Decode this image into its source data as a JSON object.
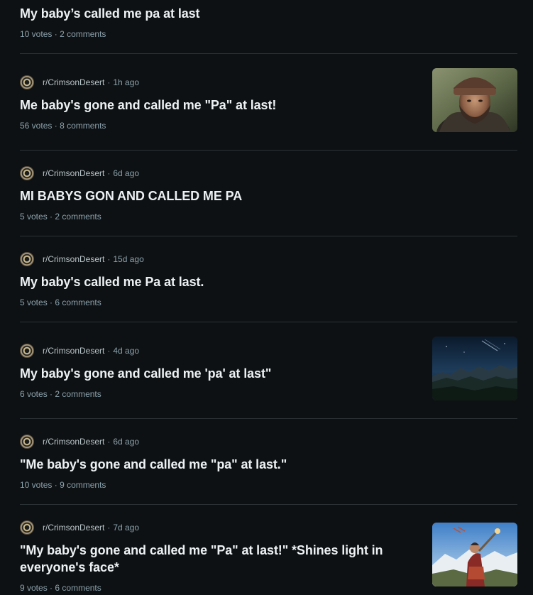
{
  "posts": [
    {
      "title": "My baby’s called me pa at last",
      "votes": "10 votes",
      "sep": "·",
      "comments": "2 comments"
    },
    {
      "subreddit": "r/CrimsonDesert",
      "sep": "·",
      "age": "1h ago",
      "title": "Me baby's gone and called me \"Pa\" at last!",
      "votes": "56 votes",
      "comments": "8 comments",
      "thumbnail": "character-portrait"
    },
    {
      "subreddit": "r/CrimsonDesert",
      "sep": "·",
      "age": "6d ago",
      "title": "MI BABYS GON AND CALLED ME PA",
      "votes": "5 votes",
      "comments": "2 comments"
    },
    {
      "subreddit": "r/CrimsonDesert",
      "sep": "·",
      "age": "15d ago",
      "title": "My baby's called me Pa at last.",
      "votes": "5 votes",
      "comments": "6 comments"
    },
    {
      "subreddit": "r/CrimsonDesert",
      "sep": "·",
      "age": "4d ago",
      "title": "My baby's gone and called me 'pa' at last\"",
      "votes": "6 votes",
      "comments": "2 comments",
      "thumbnail": "night-landscape"
    },
    {
      "subreddit": "r/CrimsonDesert",
      "sep": "·",
      "age": "6d ago",
      "title": "\"Me baby's gone and called me \"pa\" at last.\"",
      "votes": "10 votes",
      "comments": "9 comments"
    },
    {
      "subreddit": "r/CrimsonDesert",
      "sep": "·",
      "age": "7d ago",
      "title_line1": "\"My baby's gone and called me \"Pa\" at last!\" *Shines light in",
      "title_line2": "everyone's face*",
      "votes": "9 votes",
      "comments": "6 comments",
      "thumbnail": "character-raising-lantern"
    }
  ],
  "colors": {
    "background": "#0e1113",
    "title": "#eef1f3",
    "meta": "#8ba2ad",
    "divider": "#2a3236"
  }
}
